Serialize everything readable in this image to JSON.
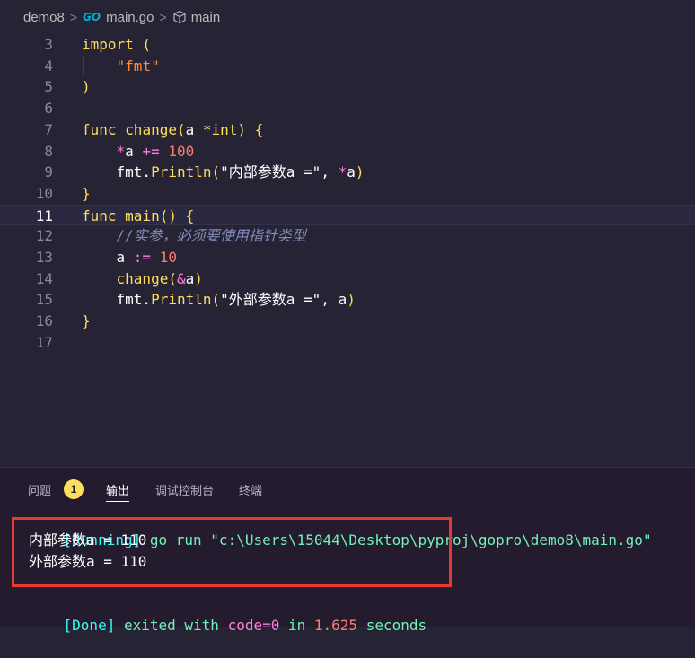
{
  "breadcrumb": {
    "folder": "demo8",
    "go_badge": "GO",
    "file": "main.go",
    "symbol": "main"
  },
  "code_lines": [
    {
      "n": "3",
      "tokens": [
        {
          "t": "import",
          "c": "kw"
        },
        {
          "t": " (",
          "c": "kw"
        }
      ]
    },
    {
      "n": "4",
      "tokens": [
        {
          "t": "    \"",
          "c": "str"
        },
        {
          "t": "fmt",
          "c": "str-u"
        },
        {
          "t": "\"",
          "c": "str"
        }
      ]
    },
    {
      "n": "5",
      "tokens": [
        {
          "t": ")",
          "c": "kw"
        }
      ]
    },
    {
      "n": "6",
      "tokens": []
    },
    {
      "n": "7",
      "tokens": [
        {
          "t": "func",
          "c": "kw"
        },
        {
          "t": " ",
          "c": "pl"
        },
        {
          "t": "change",
          "c": "kw"
        },
        {
          "t": "(",
          "c": "kw"
        },
        {
          "t": "a ",
          "c": "pl"
        },
        {
          "t": "*int",
          "c": "kw"
        },
        {
          "t": ") {",
          "c": "kw"
        }
      ]
    },
    {
      "n": "8",
      "tokens": [
        {
          "t": "    ",
          "c": "pl"
        },
        {
          "t": "*",
          "c": "id"
        },
        {
          "t": "a ",
          "c": "pl"
        },
        {
          "t": "+= ",
          "c": "id"
        },
        {
          "t": "100",
          "c": "num"
        }
      ]
    },
    {
      "n": "9",
      "tokens": [
        {
          "t": "    fmt.",
          "c": "pl"
        },
        {
          "t": "Println",
          "c": "kw"
        },
        {
          "t": "(",
          "c": "kw"
        },
        {
          "t": "\"内部参数a =\"",
          "c": "pl"
        },
        {
          "t": ", ",
          "c": "pl"
        },
        {
          "t": "*",
          "c": "id"
        },
        {
          "t": "a",
          "c": "pl"
        },
        {
          "t": ")",
          "c": "kw"
        }
      ]
    },
    {
      "n": "10",
      "tokens": [
        {
          "t": "}",
          "c": "kw"
        }
      ]
    },
    {
      "n": "11",
      "tokens": [
        {
          "t": "func",
          "c": "kw"
        },
        {
          "t": " ",
          "c": "pl"
        },
        {
          "t": "main",
          "c": "kw"
        },
        {
          "t": "() {",
          "c": "kw"
        }
      ],
      "current": true
    },
    {
      "n": "12",
      "tokens": [
        {
          "t": "    //实参，必须要使用指针类型",
          "c": "cm"
        }
      ]
    },
    {
      "n": "13",
      "tokens": [
        {
          "t": "    a ",
          "c": "pl"
        },
        {
          "t": ":= ",
          "c": "id"
        },
        {
          "t": "10",
          "c": "num"
        }
      ]
    },
    {
      "n": "14",
      "tokens": [
        {
          "t": "    ",
          "c": "pl"
        },
        {
          "t": "change",
          "c": "kw"
        },
        {
          "t": "(",
          "c": "kw"
        },
        {
          "t": "&",
          "c": "id"
        },
        {
          "t": "a",
          "c": "pl"
        },
        {
          "t": ")",
          "c": "kw"
        }
      ]
    },
    {
      "n": "15",
      "tokens": [
        {
          "t": "    fmt.",
          "c": "pl"
        },
        {
          "t": "Println",
          "c": "kw"
        },
        {
          "t": "(",
          "c": "kw"
        },
        {
          "t": "\"外部参数a =\"",
          "c": "pl"
        },
        {
          "t": ", ",
          "c": "pl"
        },
        {
          "t": "a",
          "c": "pl"
        },
        {
          "t": ")",
          "c": "kw"
        }
      ]
    },
    {
      "n": "16",
      "tokens": [
        {
          "t": "}",
          "c": "kw"
        }
      ]
    },
    {
      "n": "17",
      "tokens": []
    }
  ],
  "panel": {
    "tabs": [
      {
        "label": "问题",
        "badge": "1"
      },
      {
        "label": "输出",
        "active": true
      },
      {
        "label": "调试控制台"
      },
      {
        "label": "终端"
      }
    ],
    "output": {
      "running_tag": "[Running]",
      "running_cmd": " go run \"c:\\Users\\15044\\Desktop\\pyproj\\gopro\\demo8\\main.go\"",
      "line1": "内部参数a = 110",
      "line2": "外部参数a = 110",
      "done_tag": "[Done]",
      "done_exited": " exited with ",
      "done_code": "code=0",
      "done_in": " in ",
      "done_time": "1.625",
      "done_seconds": " seconds"
    }
  },
  "colors": {
    "background": "#262335",
    "keyword": "#fede5d",
    "number": "#f97e72",
    "operator": "#ff7edb",
    "comment": "#848bbd",
    "highlight_box": "#e53935"
  }
}
